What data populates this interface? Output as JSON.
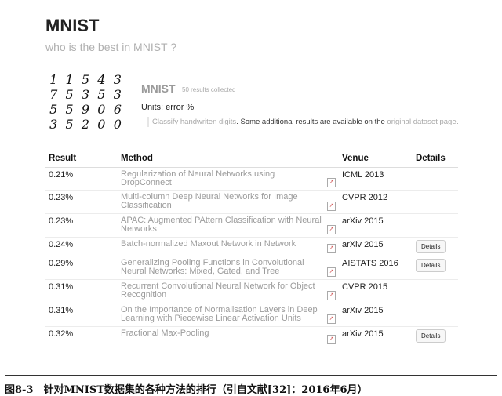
{
  "header": {
    "title": "MNIST",
    "subtitle": "who is the best in MNIST ?"
  },
  "dataset": {
    "digit_rows": [
      "11543",
      "75353",
      "55906",
      "35200"
    ],
    "name": "MNIST",
    "count": "50 results collected",
    "units": "Units: error %",
    "desc_link1": "Classify handwriten digits",
    "desc_mid": ". Some additional results are available on the ",
    "desc_link2": "original dataset page",
    "desc_end": "."
  },
  "table": {
    "headers": [
      "Result",
      "Method",
      "Venue",
      "Details"
    ],
    "rows": [
      {
        "result": "0.21%",
        "method": "Regularization of Neural Networks using DropConnect",
        "venue": "ICML 2013",
        "details": ""
      },
      {
        "result": "0.23%",
        "method": "Multi-column Deep Neural Networks for Image Classification",
        "venue": "CVPR 2012",
        "details": ""
      },
      {
        "result": "0.23%",
        "method": "APAC: Augmented PAttern Classification with Neural Networks",
        "venue": "arXiv 2015",
        "details": ""
      },
      {
        "result": "0.24%",
        "method": "Batch-normalized Maxout Network in Network",
        "venue": "arXiv 2015",
        "details": "Details"
      },
      {
        "result": "0.29%",
        "method": "Generalizing Pooling Functions in Convolutional Neural Networks: Mixed, Gated, and Tree",
        "venue": "AISTATS 2016",
        "details": "Details"
      },
      {
        "result": "0.31%",
        "method": "Recurrent Convolutional Neural Network for Object Recognition",
        "venue": "CVPR 2015",
        "details": ""
      },
      {
        "result": "0.31%",
        "method": "On the Importance of Normalisation Layers in Deep Learning with Piecewise Linear Activation Units",
        "venue": "arXiv 2015",
        "details": ""
      },
      {
        "result": "0.32%",
        "method": "Fractional Max-Pooling",
        "venue": "arXiv 2015",
        "details": "Details"
      }
    ]
  },
  "pdf_icon": "pdf-icon",
  "caption": "图8-3　针对MNIST数据集的各种方法的排行（引自文献[32]：2016年6月）"
}
